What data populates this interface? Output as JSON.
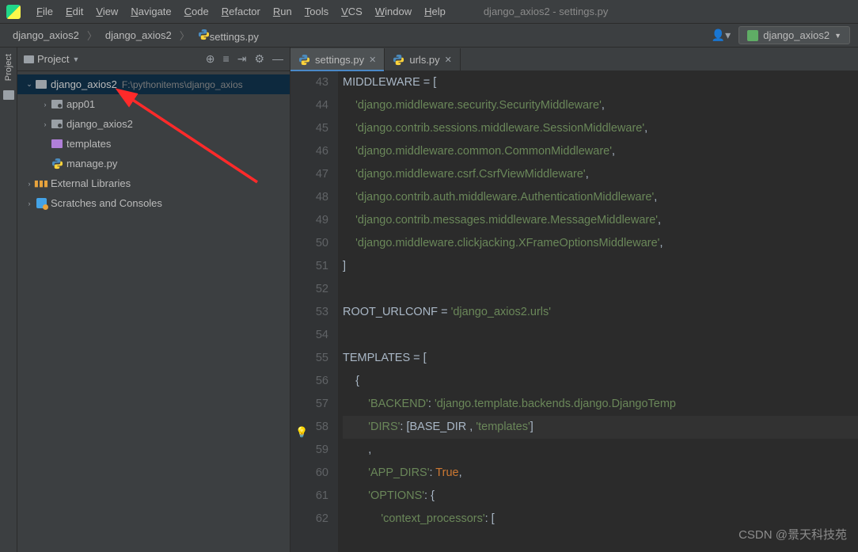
{
  "title": "django_axios2 - settings.py",
  "menu": [
    "File",
    "Edit",
    "View",
    "Navigate",
    "Code",
    "Refactor",
    "Run",
    "Tools",
    "VCS",
    "Window",
    "Help"
  ],
  "breadcrumbs": [
    "django_axios2",
    "django_axios2",
    "settings.py"
  ],
  "run_config": "django_axios2",
  "project_panel": {
    "title": "Project",
    "tree": [
      {
        "depth": 0,
        "exp": true,
        "icon": "folder",
        "label": "django_axios2",
        "path": "F:\\pythonitems\\django_axios",
        "selected": true
      },
      {
        "depth": 1,
        "exp": false,
        "icon": "pkg",
        "label": "app01"
      },
      {
        "depth": 1,
        "exp": false,
        "icon": "pkg",
        "label": "django_axios2"
      },
      {
        "depth": 1,
        "exp": null,
        "icon": "purple",
        "label": "templates"
      },
      {
        "depth": 1,
        "exp": null,
        "icon": "py",
        "label": "manage.py"
      },
      {
        "depth": 0,
        "exp": false,
        "icon": "lib",
        "label": "External Libraries"
      },
      {
        "depth": 0,
        "exp": false,
        "icon": "scratch",
        "label": "Scratches and Consoles"
      }
    ]
  },
  "tabs": [
    {
      "label": "settings.py",
      "active": true
    },
    {
      "label": "urls.py",
      "active": false
    }
  ],
  "code": {
    "first_line": 43,
    "highlight_line": 58,
    "bulb_line": 58,
    "lines": [
      [
        {
          "t": "MIDDLEWARE ",
          "c": "ident"
        },
        {
          "t": "= [",
          "c": "op"
        }
      ],
      [
        {
          "t": "    ",
          "c": "op"
        },
        {
          "t": "'django.middleware.security.SecurityMiddleware'",
          "c": "str"
        },
        {
          "t": ",",
          "c": "op"
        }
      ],
      [
        {
          "t": "    ",
          "c": "op"
        },
        {
          "t": "'django.contrib.sessions.middleware.SessionMiddleware'",
          "c": "str"
        },
        {
          "t": ",",
          "c": "op"
        }
      ],
      [
        {
          "t": "    ",
          "c": "op"
        },
        {
          "t": "'django.middleware.common.CommonMiddleware'",
          "c": "str"
        },
        {
          "t": ",",
          "c": "op"
        }
      ],
      [
        {
          "t": "    ",
          "c": "op"
        },
        {
          "t": "'django.middleware.csrf.CsrfViewMiddleware'",
          "c": "str"
        },
        {
          "t": ",",
          "c": "op"
        }
      ],
      [
        {
          "t": "    ",
          "c": "op"
        },
        {
          "t": "'django.contrib.auth.middleware.AuthenticationMiddleware'",
          "c": "str"
        },
        {
          "t": ",",
          "c": "op"
        }
      ],
      [
        {
          "t": "    ",
          "c": "op"
        },
        {
          "t": "'django.contrib.messages.middleware.MessageMiddleware'",
          "c": "str"
        },
        {
          "t": ",",
          "c": "op"
        }
      ],
      [
        {
          "t": "    ",
          "c": "op"
        },
        {
          "t": "'django.middleware.clickjacking.XFrameOptionsMiddleware'",
          "c": "str"
        },
        {
          "t": ",",
          "c": "op"
        }
      ],
      [
        {
          "t": "]",
          "c": "op"
        }
      ],
      [],
      [
        {
          "t": "ROOT_URLCONF ",
          "c": "ident"
        },
        {
          "t": "= ",
          "c": "op"
        },
        {
          "t": "'django_axios2.urls'",
          "c": "str"
        }
      ],
      [],
      [
        {
          "t": "TEMPLATES ",
          "c": "ident"
        },
        {
          "t": "= [",
          "c": "op"
        }
      ],
      [
        {
          "t": "    {",
          "c": "op"
        }
      ],
      [
        {
          "t": "        ",
          "c": "op"
        },
        {
          "t": "'BACKEND'",
          "c": "str"
        },
        {
          "t": ": ",
          "c": "op"
        },
        {
          "t": "'django.template.backends.django.DjangoTemp",
          "c": "str"
        }
      ],
      [
        {
          "t": "        ",
          "c": "op"
        },
        {
          "t": "'DIRS'",
          "c": "str"
        },
        {
          "t": ": [",
          "c": "op"
        },
        {
          "t": "BASE_DIR ",
          "c": "ident"
        },
        {
          "t": ", ",
          "c": "op"
        },
        {
          "t": "'templates'",
          "c": "str"
        },
        {
          "t": "]",
          "c": "op"
        }
      ],
      [
        {
          "t": "        ,",
          "c": "op"
        }
      ],
      [
        {
          "t": "        ",
          "c": "op"
        },
        {
          "t": "'APP_DIRS'",
          "c": "str"
        },
        {
          "t": ": ",
          "c": "op"
        },
        {
          "t": "True",
          "c": "const"
        },
        {
          "t": ",",
          "c": "op"
        }
      ],
      [
        {
          "t": "        ",
          "c": "op"
        },
        {
          "t": "'OPTIONS'",
          "c": "str"
        },
        {
          "t": ": {",
          "c": "op"
        }
      ],
      [
        {
          "t": "            ",
          "c": "op"
        },
        {
          "t": "'context_processors'",
          "c": "str"
        },
        {
          "t": ": [",
          "c": "op"
        }
      ]
    ]
  },
  "watermark": "CSDN @景天科技苑"
}
